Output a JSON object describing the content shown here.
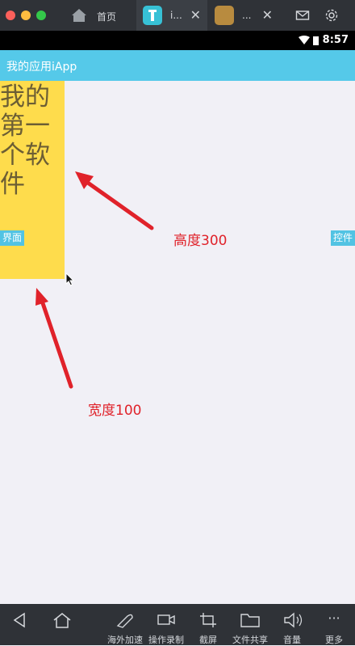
{
  "window": {
    "tabs": [
      {
        "label": "首页",
        "icon": "home-icon"
      },
      {
        "label": "i...",
        "icon": "iapp-icon"
      },
      {
        "label": "...",
        "icon": "folder-icon"
      }
    ]
  },
  "status": {
    "time": "8:57"
  },
  "app": {
    "title": "我的应用iApp"
  },
  "content": {
    "big_text": "我的第一个软件",
    "left_button": "界面",
    "right_button": "控件"
  },
  "annotations": {
    "height": "高度300",
    "width": "宽度100"
  },
  "bottom_bar": {
    "items": [
      "海外加速",
      "操作录制",
      "截屏",
      "文件共享",
      "音量",
      "更多"
    ]
  },
  "colors": {
    "accent": "#55c9e9",
    "yellow_box": "#fedc4c",
    "annotation_red": "#e0222a"
  }
}
